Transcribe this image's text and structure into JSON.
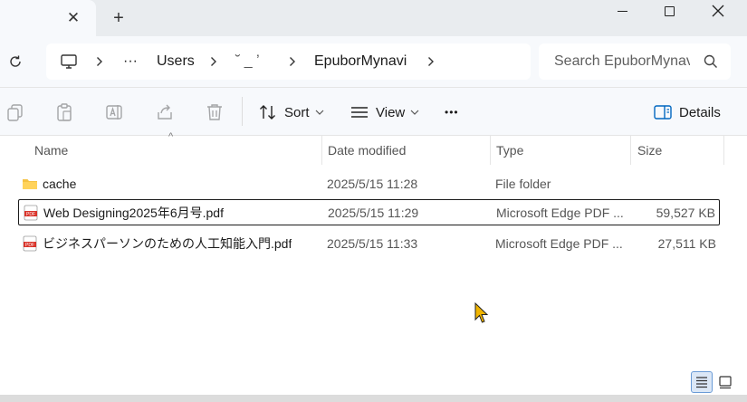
{
  "tab": {
    "close_glyph": "✕",
    "new_tab_glyph": "+"
  },
  "address": {
    "crumbs": [
      "···",
      "Users",
      "˘ _ ʼ",
      "EpuborMynavi"
    ],
    "search_placeholder": "Search EpuborMynavi"
  },
  "commands": {
    "sort_label": "Sort",
    "view_label": "View",
    "more_glyph": "•••",
    "details_label": "Details"
  },
  "columns": {
    "name": "Name",
    "date": "Date modified",
    "type": "Type",
    "size": "Size"
  },
  "files": [
    {
      "name": "cache",
      "date": "2025/5/15 11:28",
      "type": "File folder",
      "size": "",
      "kind": "folder-icon"
    },
    {
      "name": "Web Designing2025年6月号.pdf",
      "date": "2025/5/15 11:29",
      "type": "Microsoft Edge PDF ...",
      "size": "59,527 KB",
      "kind": "pdf-icon"
    },
    {
      "name": "ビジネスパーソンのための人工知能入門.pdf",
      "date": "2025/5/15 11:33",
      "type": "Microsoft Edge PDF ...",
      "size": "27,511 KB",
      "kind": "pdf-icon"
    }
  ],
  "colors": {
    "accent": "#0067c0",
    "folder": "#f5c242",
    "pdf": "#d9342b",
    "cursor": "#f0b400"
  }
}
